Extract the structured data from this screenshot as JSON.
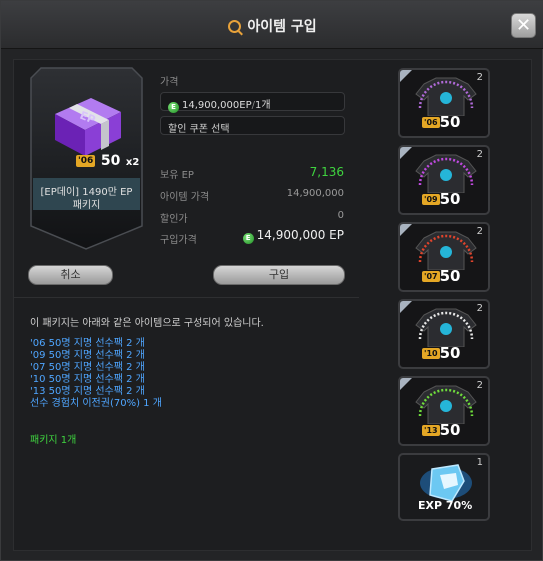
{
  "window": {
    "title": "아이템 구입",
    "close_label": "✕"
  },
  "product": {
    "name": "[EP데이] 1490만 EP 패키지",
    "badge": {
      "year": "'06",
      "number": "50",
      "multiplier": "x2"
    },
    "box_text": "EP"
  },
  "price": {
    "label": "가격",
    "amount": "14,900,000EP",
    "separator": "/",
    "quantity": "1개",
    "coupon_placeholder": "할인 쿠폰 선택"
  },
  "summary": {
    "owned_label": "보유 EP",
    "owned_value": "7,136",
    "item_price_label": "아이템 가격",
    "item_price_value": "14,900,000",
    "discount_label": "할인가",
    "discount_value": "0",
    "purchase_price_label": "구입가격",
    "purchase_price_value": "14,900,000 EP"
  },
  "buttons": {
    "cancel": "취소",
    "buy": "구입"
  },
  "description": "이 패키지는 아래와 같은 아이템으로 구성되어 있습니다.",
  "contents": [
    "'06 50명 지명 선수팩 2 개",
    "'09 50명 지명 선수팩 2 개",
    "'07 50명 지명 선수팩 2 개",
    "'10 50명 지명 선수팩 2 개",
    "'13 50명 지명 선수팩 2 개",
    "선수 경험치 이전권(70%) 1 개"
  ],
  "package_count": "패키지 1개",
  "thumbnails": [
    {
      "year": "'06",
      "number": "50",
      "count": "2",
      "color": "#b06ad8"
    },
    {
      "year": "'09",
      "number": "50",
      "count": "2",
      "color": "#c04ae0"
    },
    {
      "year": "'07",
      "number": "50",
      "count": "2",
      "color": "#e0442c"
    },
    {
      "year": "'10",
      "number": "50",
      "count": "2",
      "color": "#e8e8e8"
    },
    {
      "year": "'13",
      "number": "50",
      "count": "2",
      "color": "#6fdc3c"
    }
  ],
  "ticket": {
    "label": "EXP 70%",
    "count": "1"
  },
  "colors": {
    "accent_green": "#3fd43f",
    "list_blue": "#4fa6ff",
    "badge_gold": "#e4a725",
    "box_purple": "#8a3fd6"
  }
}
